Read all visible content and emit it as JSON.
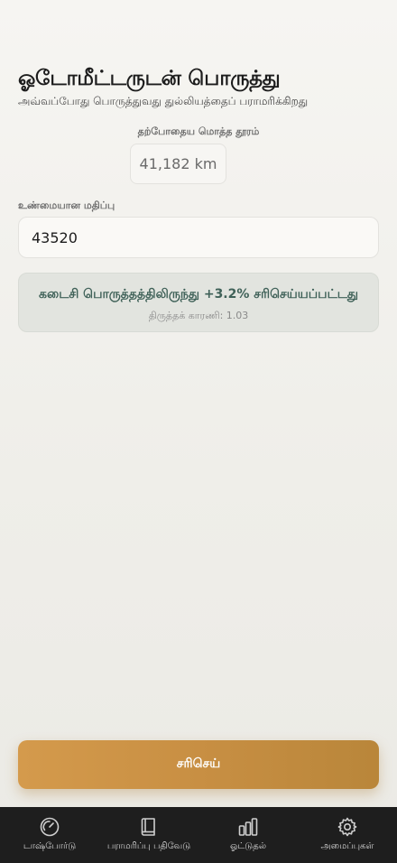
{
  "header": {
    "title": "ஓடோமீட்டருடன் பொருத்து",
    "subtitle": "அவ்வப்போது பொருத்துவது துல்லியத்தைப் பராமரிக்கிறது"
  },
  "current_distance": {
    "label": "தற்போதைய மொத்த தூரம்",
    "value": "41,182 km"
  },
  "actual_value": {
    "label": "உண்மையான மதிப்பு",
    "value": "43520"
  },
  "info_card": {
    "main": "கடைசி பொருத்தத்திலிருந்து +3.2% சரிசெய்யப்பட்டது",
    "sub": "திருத்தக் காரணி: 1.03"
  },
  "adjust_button": {
    "label": "சரிசெய்"
  },
  "tabbar": {
    "tabs": [
      {
        "label": "டாஷ்போர்டு",
        "icon": "speedometer-icon"
      },
      {
        "label": "பராமரிப்பு பதிவேடு",
        "icon": "book-icon"
      },
      {
        "label": "ஓட்டுதல்",
        "icon": "bar-chart-icon"
      },
      {
        "label": "அமைப்புகள்",
        "icon": "gear-icon"
      }
    ]
  }
}
